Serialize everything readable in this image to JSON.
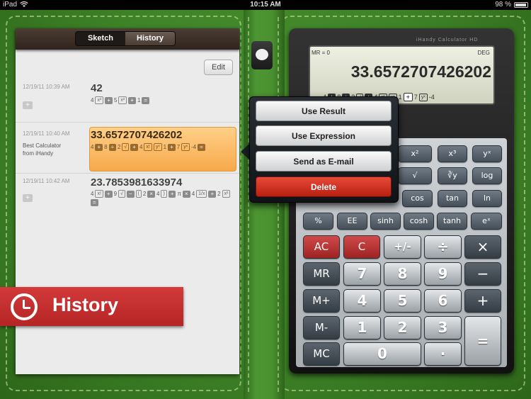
{
  "status_bar": {
    "carrier": "iPad",
    "time": "10:15 AM",
    "battery": "98 %"
  },
  "history_panel": {
    "tabs": [
      {
        "label": "Sketch"
      },
      {
        "label": "History"
      }
    ],
    "edit_label": "Edit",
    "entries": [
      {
        "date": "12/19/11 10:39 AM",
        "note": "",
        "result": "42",
        "expression": [
          "4",
          "x²",
          "+",
          "5",
          "x²",
          "+",
          "1",
          "="
        ]
      },
      {
        "date": "12/19/11 10:40 AM",
        "note_line1": "Best Calculator",
        "note_line2": "from iHandy",
        "result": "33.6572707426202",
        "expression": [
          "4",
          "+",
          "8",
          "÷",
          "2",
          "√",
          "+",
          "4",
          "x!",
          "yˣ",
          "1",
          "+",
          "7",
          "yˣ",
          "-4",
          "="
        ]
      },
      {
        "date": "12/19/11 10:42 AM",
        "note": "",
        "result": "23.7853981633974",
        "expression_line1": [
          "4",
          "x!",
          "+",
          "9",
          "√",
          "−",
          "(",
          "2",
          "×",
          "4",
          ")",
          "+",
          "π",
          "×",
          "4",
          "1/x"
        ],
        "expression_line2": [
          "+",
          "2",
          "x²",
          "="
        ]
      }
    ],
    "banner_label": "History"
  },
  "popup_menu": {
    "items": [
      "Use Result",
      "Use Expression",
      "Send as E-mail",
      "Delete"
    ]
  },
  "calculator": {
    "brand": "iHandy Calculator HD",
    "display": {
      "memory": "MR = 0",
      "mode": "DEG",
      "value": "33.6572707426202",
      "expression": [
        "4",
        "+",
        "8",
        "÷",
        "2",
        "√",
        "+",
        "4",
        "x!",
        "yˣ",
        "1",
        "+",
        "7",
        "yˣ",
        "-4"
      ]
    },
    "sci_keys": {
      "row1": [
        "x²",
        "x³",
        "yˣ"
      ],
      "row2": [
        "√",
        "∛y",
        "log"
      ],
      "row3": [
        "cos",
        "tan",
        "ln"
      ],
      "row4": [
        "%",
        "EE",
        "sinh",
        "cosh",
        "tanh",
        "eˣ"
      ]
    },
    "main_keys": {
      "ac": "AC",
      "c": "C",
      "plus_minus": "+/-",
      "divide": "÷",
      "multiply": "×",
      "mr": "MR",
      "m_plus": "M+",
      "m_minus": "M-",
      "mc": "MC",
      "minus": "−",
      "plus": "+",
      "equals": "=",
      "dot": "·",
      "d7": "7",
      "d8": "8",
      "d9": "9",
      "d4": "4",
      "d5": "5",
      "d6": "6",
      "d1": "1",
      "d2": "2",
      "d3": "3",
      "d0": "0"
    }
  },
  "colors": {
    "leather": "#3f8428",
    "banner": "#c72f2f",
    "selection": "#f7a94a",
    "delete": "#d0301f"
  }
}
